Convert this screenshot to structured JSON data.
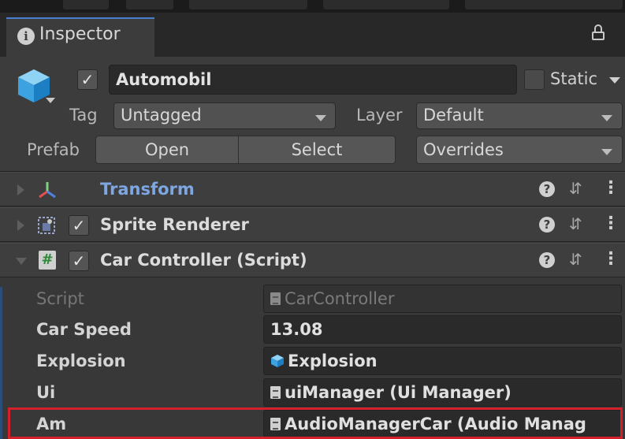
{
  "window": {
    "tab_title": "Inspector",
    "icons": [
      "info-icon",
      "lock-icon"
    ]
  },
  "gameobject": {
    "name": "Automobil",
    "active": true,
    "static_label": "Static",
    "static_checked": false,
    "tag_label": "Tag",
    "tag_value": "Untagged",
    "layer_label": "Layer",
    "layer_value": "Default",
    "prefab_label": "Prefab",
    "open_label": "Open",
    "select_label": "Select",
    "overrides_label": "Overrides"
  },
  "components": [
    {
      "name": "Transform",
      "icon": "transform-icon",
      "expanded": false,
      "has_checkbox": false
    },
    {
      "name": "Sprite Renderer",
      "icon": "sprite-renderer-icon",
      "expanded": false,
      "has_checkbox": true,
      "enabled": true
    },
    {
      "name": "Car Controller (Script)",
      "icon": "script-icon",
      "expanded": true,
      "has_checkbox": true,
      "enabled": true
    }
  ],
  "properties": [
    {
      "label": "Script",
      "value": "CarController",
      "type": "script-ref",
      "disabled": true
    },
    {
      "label": "Car Speed",
      "value": "13.08",
      "type": "number"
    },
    {
      "label": "Explosion",
      "value": "Explosion",
      "type": "prefab-ref"
    },
    {
      "label": "Ui",
      "value": "uiManager (Ui Manager)",
      "type": "script-ref"
    },
    {
      "label": "Am",
      "value": "AudioManagerCar (Audio Manag",
      "type": "script-ref",
      "highlighted": true
    }
  ],
  "colors": {
    "accent": "#4a7fd0",
    "transform_title": "#7ea6e0",
    "highlight": "#d4202a"
  },
  "help_icon": "?",
  "preset_icon": "⇵",
  "menu_icon": "⋮"
}
